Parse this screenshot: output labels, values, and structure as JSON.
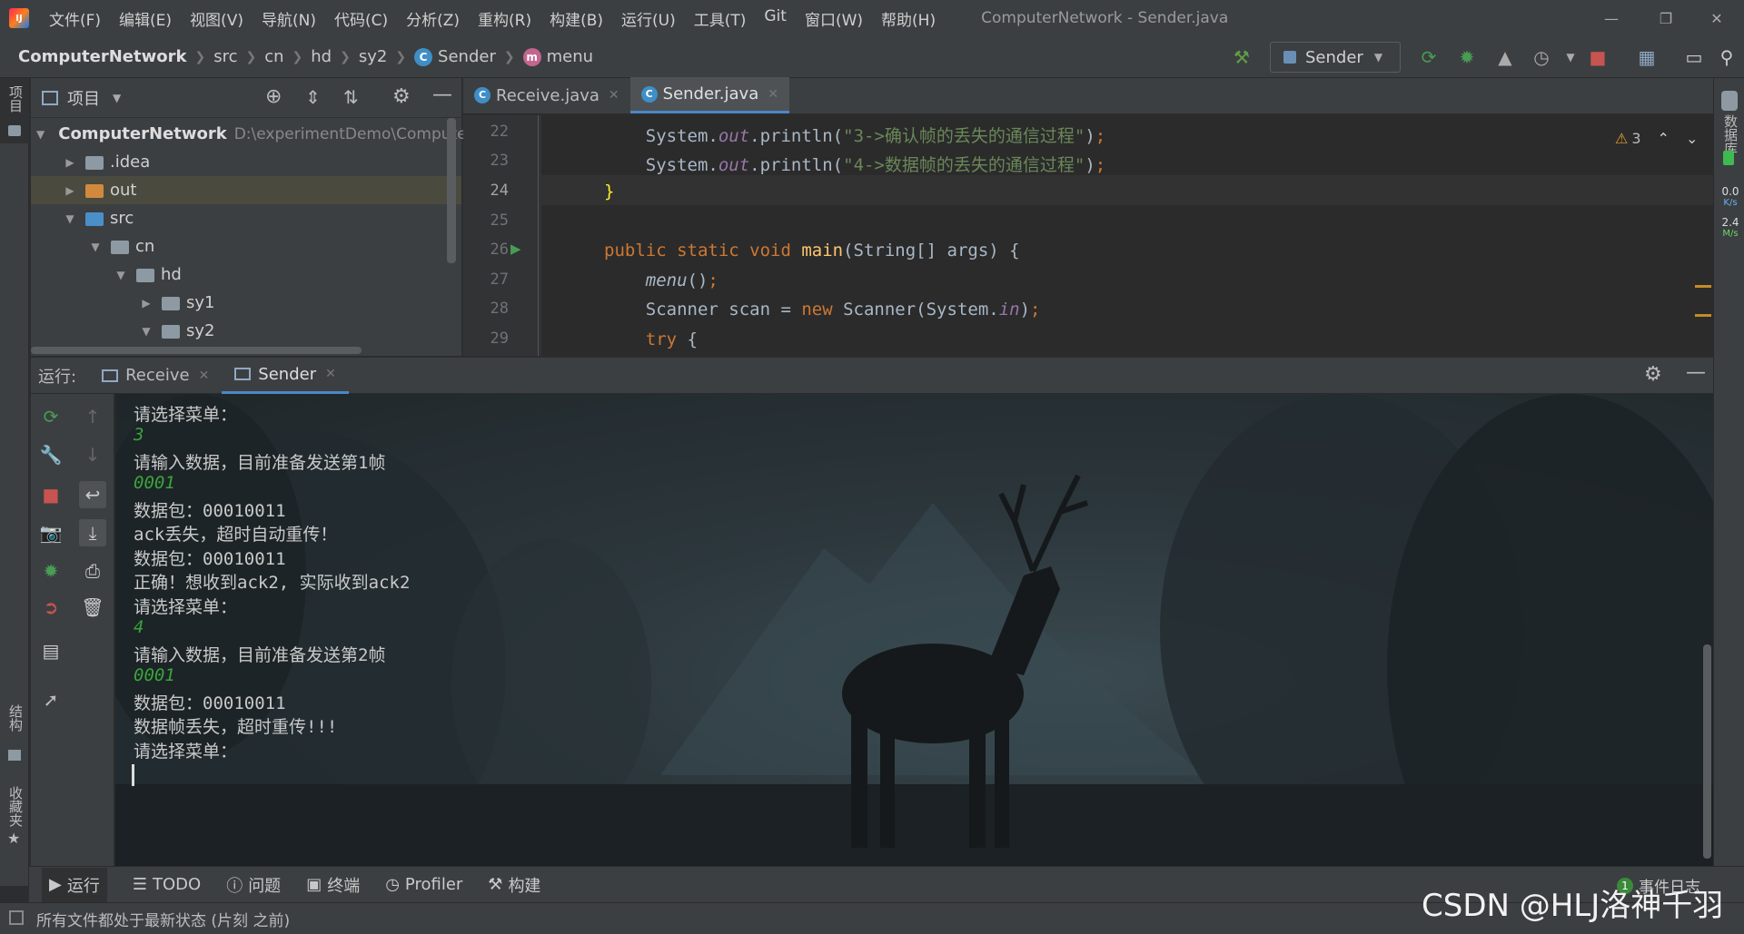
{
  "titlebar": {
    "menus": [
      "文件(F)",
      "编辑(E)",
      "视图(V)",
      "导航(N)",
      "代码(C)",
      "分析(Z)",
      "重构(R)",
      "构建(B)",
      "运行(U)",
      "工具(T)",
      "Git",
      "窗口(W)",
      "帮助(H)"
    ],
    "title": "ComputerNetwork - Sender.java"
  },
  "breadcrumb": [
    "ComputerNetwork",
    "src",
    "cn",
    "hd",
    "sy2",
    "Sender",
    "menu"
  ],
  "run_config": "Sender",
  "left_strip": {
    "project": "项目",
    "structure": "结构",
    "favorites": "收藏夹"
  },
  "right_strip": {
    "database": "数据库",
    "speed_up": "0.0",
    "speed_up_unit": "K/s",
    "speed_down": "2.4",
    "speed_down_unit": "M/s"
  },
  "project_panel": {
    "title": "项目",
    "tree": [
      {
        "label": "ComputerNetwork",
        "path": "D:\\experimentDemo\\Compute"
      },
      {
        "label": ".idea"
      },
      {
        "label": "out"
      },
      {
        "label": "src"
      },
      {
        "label": "cn"
      },
      {
        "label": "hd"
      },
      {
        "label": "sy1"
      },
      {
        "label": "sy2"
      }
    ]
  },
  "editor": {
    "tabs": [
      "Receive.java",
      "Sender.java"
    ],
    "warning_count": "3",
    "line_numbers": [
      "22",
      "23",
      "24",
      "25",
      "26",
      "27",
      "28",
      "29"
    ]
  },
  "run_panel": {
    "label": "运行:",
    "tabs": [
      "Receive",
      "Sender"
    ],
    "console": [
      {
        "text": "请选择菜单：",
        "input": false
      },
      {
        "text": "3",
        "input": true
      },
      {
        "text": "请输入数据，目前准备发送第1帧",
        "input": false
      },
      {
        "text": "0001",
        "input": true
      },
      {
        "text": "数据包：00010011",
        "input": false
      },
      {
        "text": "ack丢失，超时自动重传！",
        "input": false
      },
      {
        "text": "数据包：00010011",
        "input": false
      },
      {
        "text": "正确！想收到ack2, 实际收到ack2",
        "input": false
      },
      {
        "text": "请选择菜单：",
        "input": false
      },
      {
        "text": "4",
        "input": true
      },
      {
        "text": "请输入数据，目前准备发送第2帧",
        "input": false
      },
      {
        "text": "0001",
        "input": true
      },
      {
        "text": "数据包：00010011",
        "input": false
      },
      {
        "text": "数据帧丢失，超时重传!!!",
        "input": false
      },
      {
        "text": "请选择菜单：",
        "input": false
      }
    ]
  },
  "bottom_tabs": [
    "运行",
    "TODO",
    "问题",
    "终端",
    "Profiler",
    "构建"
  ],
  "event_log": {
    "count": "1",
    "label": "事件日志"
  },
  "status": {
    "message": "所有文件都处于最新状态 (片刻 之前)"
  },
  "watermark": "CSDN @HLJ洛神千羽",
  "colors": {
    "accent": "#4a88c7",
    "keyword": "#cc7832",
    "string": "#6a8759",
    "input_green": "#3aa53a",
    "warning": "#e0a030"
  }
}
